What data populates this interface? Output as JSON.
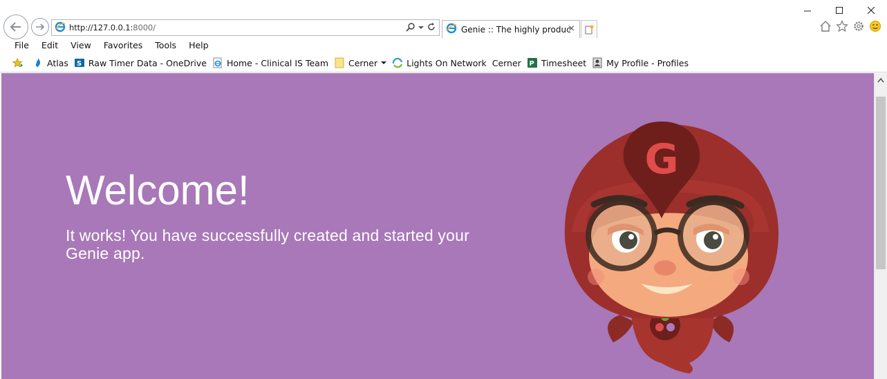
{
  "browser": {
    "address_url_host": "http://127.0.0.1:",
    "address_url_port": "8000/",
    "tab_title": "Genie :: The highly producti...",
    "tab_close": "×"
  },
  "menu": [
    "File",
    "Edit",
    "View",
    "Favorites",
    "Tools",
    "Help"
  ],
  "favorites": [
    {
      "label": "Atlas",
      "icon": "atlas-flame-icon"
    },
    {
      "label": "Raw Timer Data - OneDrive",
      "icon": "sharepoint-icon"
    },
    {
      "label": "Home - Clinical IS Team",
      "icon": "ie-page-icon"
    },
    {
      "label": "Cerner",
      "icon": "folder-icon"
    },
    {
      "label": "Lights On Network",
      "icon": "lights-on-icon"
    },
    {
      "label": "Cerner",
      "icon": "none"
    },
    {
      "label": "Timesheet",
      "icon": "project-icon"
    },
    {
      "label": "My Profile - Profiles",
      "icon": "profile-icon"
    }
  ],
  "page": {
    "title": "Welcome!",
    "subtitle": "It works! You have successfully created and started your Genie app.",
    "background": "#a878b8",
    "mascot_letter": "G"
  },
  "colors": {
    "mascot_hood": "#9c2f2b",
    "mascot_skin": "#f4a97f",
    "mascot_logo": "#e04c4c"
  }
}
